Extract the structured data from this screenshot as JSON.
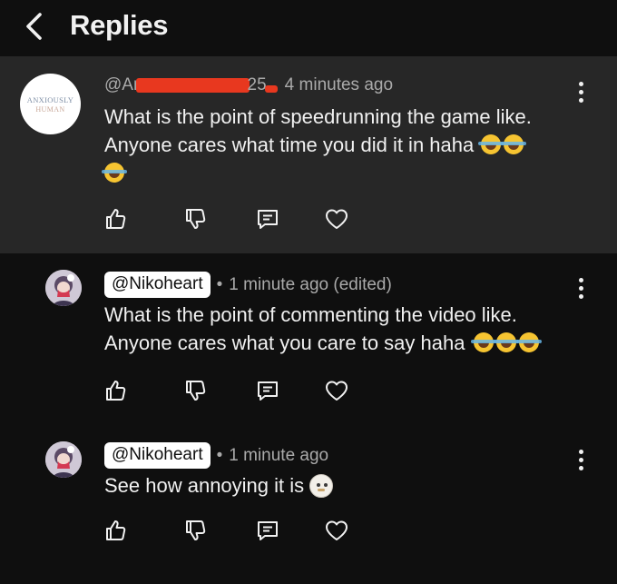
{
  "header": {
    "title": "Replies",
    "back_icon": "chevron-left-icon"
  },
  "main_comment": {
    "avatar_line1": "ANXIOUSLY",
    "avatar_line2": "HUMAN",
    "handle_visible_start": "@An",
    "handle_visible_end": "25",
    "time": "4 minutes ago",
    "text_line1": "What is the point of speedrunning the game like.",
    "text_line2": "Anyone cares what time you did it in haha",
    "emoji_count": 3
  },
  "replies": [
    {
      "handle": "@Nikoheart",
      "time": "1 minute ago (edited)",
      "text_line1": "What is the point of commenting the video like.",
      "text_line2": "Anyone cares what you care to say haha",
      "emoji_count": 3
    },
    {
      "handle": "@Nikoheart",
      "time": "1 minute ago",
      "text_line1": "See how annoying it is",
      "emoji_count": 1
    }
  ],
  "actions": [
    "like-icon",
    "dislike-icon",
    "reply-icon",
    "heart-icon"
  ],
  "colors": {
    "background": "#0f0f0f",
    "highlight": "#272727",
    "redaction": "#e8381f",
    "text": "#f1f1f1",
    "meta": "#aaaaaa"
  }
}
